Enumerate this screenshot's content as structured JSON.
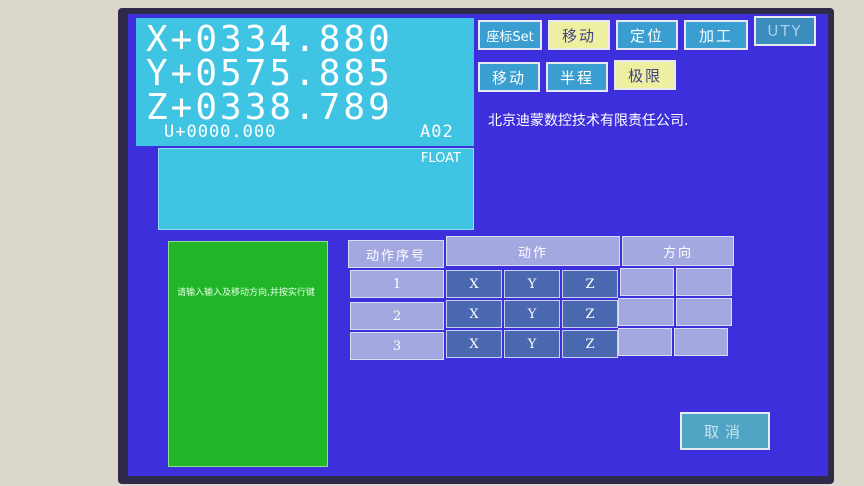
{
  "coords": {
    "x": "X+0334.880",
    "y": "Y+0575.885",
    "z": "Z+0338.789",
    "u": "U+0000.000",
    "program": "A02",
    "status": "FLOAT"
  },
  "top_buttons": [
    {
      "label": "座标Set",
      "style": "teal"
    },
    {
      "label": "移动",
      "style": "yellow"
    },
    {
      "label": "定位",
      "style": "teal"
    },
    {
      "label": "加工",
      "style": "teal"
    },
    {
      "label": "UTY",
      "style": "dim"
    },
    {
      "label": "移动",
      "style": "teal"
    },
    {
      "label": "半程",
      "style": "teal"
    },
    {
      "label": "极限",
      "style": "yellow"
    }
  ],
  "company": "北京迪蒙数控技术有限责任公司.",
  "prompt": "请输入输入及移动方向,并按实行键",
  "table": {
    "headers": {
      "seq": "动作序号",
      "action": "动作",
      "direction": "方向"
    },
    "rows": [
      {
        "num": "1",
        "axes": [
          "X",
          "Y",
          "Z"
        ]
      },
      {
        "num": "2",
        "axes": [
          "X",
          "Y",
          "Z"
        ]
      },
      {
        "num": "3",
        "axes": [
          "X",
          "Y",
          "Z"
        ]
      }
    ]
  },
  "cancel_label": "取消"
}
